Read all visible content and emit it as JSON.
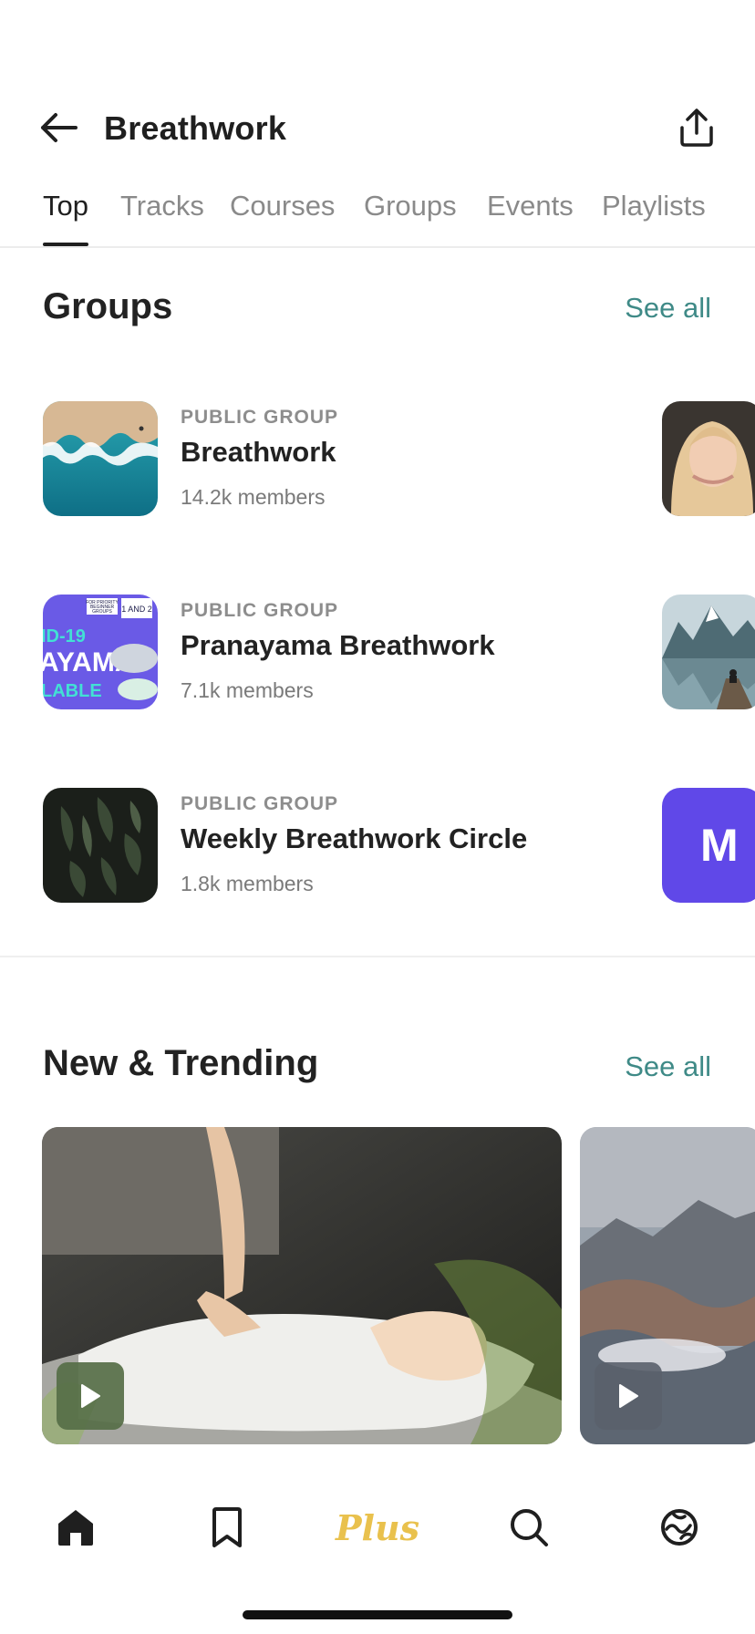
{
  "header": {
    "title": "Breathwork"
  },
  "tabs": [
    {
      "label": "Top",
      "active": true
    },
    {
      "label": "Tracks",
      "active": false
    },
    {
      "label": "Courses",
      "active": false
    },
    {
      "label": "Groups",
      "active": false
    },
    {
      "label": "Events",
      "active": false
    },
    {
      "label": "Playlists",
      "active": false
    }
  ],
  "groups_section": {
    "title": "Groups",
    "see_all": "See all",
    "items": [
      {
        "kicker": "PUBLIC GROUP",
        "name": "Breathwork",
        "members": "14.2k members"
      },
      {
        "kicker": "PUBLIC GROUP",
        "name": "Pranayama Breathwork",
        "members": "7.1k members"
      },
      {
        "kicker": "PUBLIC GROUP",
        "name": "Weekly Breathwork Circle",
        "members": "1.8k members"
      }
    ],
    "peek_letter": "M",
    "thumb2_text": {
      "top_a": "FOR PRIORITY",
      "top_b": "BEGINNER",
      "top_c": "GROUPS",
      "badge": "1 AND 2",
      "line1": "ID-19",
      "line2": "AYAMA",
      "line3": "LABLE"
    }
  },
  "trending_section": {
    "title": "New & Trending",
    "see_all": "See all"
  },
  "bottom_nav": {
    "plus_label": "Plus"
  },
  "colors": {
    "accent_teal": "#3f8a87",
    "plus_gold": "#e9c14d",
    "group_purple": "#6048e8"
  }
}
